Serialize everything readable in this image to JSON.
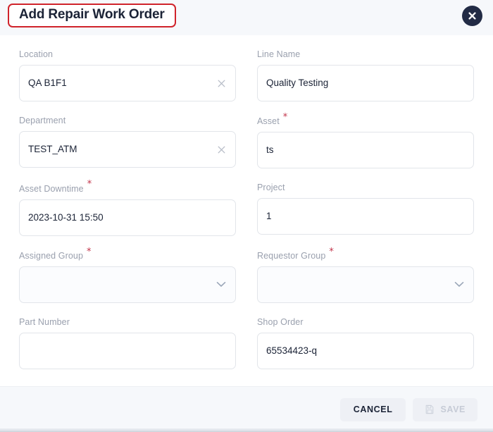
{
  "dialog": {
    "title": "Add Repair Work Order",
    "title_highlight_color": "#d0232b",
    "close_icon": "close-icon",
    "header_bg": "#f6f8fb",
    "body_bg": "#ffffff"
  },
  "form": {
    "fields": [
      {
        "label": "Location",
        "required": false,
        "value": "QA B1F1",
        "type": "text-with-clear",
        "clear_icon": "clear-x-icon",
        "name": "location"
      },
      {
        "label": "Line Name",
        "required": false,
        "value": "Quality Testing",
        "type": "text",
        "name": "line-name"
      },
      {
        "label": "Department",
        "required": false,
        "value": "TEST_ATM",
        "type": "text-with-clear",
        "clear_icon": "clear-x-icon",
        "name": "department"
      },
      {
        "label": "Asset",
        "required": true,
        "value": "ts",
        "type": "text",
        "name": "asset"
      },
      {
        "label": "Asset Downtime",
        "required": true,
        "value": "2023-10-31 15:50",
        "type": "text",
        "name": "asset-downtime"
      },
      {
        "label": "Project",
        "required": false,
        "value": "1",
        "type": "text",
        "name": "project"
      },
      {
        "label": "Assigned Group",
        "required": true,
        "value": "",
        "type": "select",
        "chevron_icon": "chevron-down-icon",
        "name": "assigned-group"
      },
      {
        "label": "Requestor Group",
        "required": true,
        "value": "",
        "type": "select",
        "chevron_icon": "chevron-down-icon",
        "name": "requestor-group"
      },
      {
        "label": "Part Number",
        "required": false,
        "value": "",
        "type": "text",
        "name": "part-number"
      },
      {
        "label": "Shop Order",
        "required": false,
        "value": "65534423-q",
        "type": "text",
        "name": "shop-order"
      }
    ],
    "required_marker": "*",
    "required_marker_color": "#c2344a"
  },
  "footer": {
    "cancel_label": "CANCEL",
    "save_label": "SAVE",
    "save_icon": "save-floppy-icon",
    "save_disabled": true,
    "bg": "#f6f8fb"
  }
}
